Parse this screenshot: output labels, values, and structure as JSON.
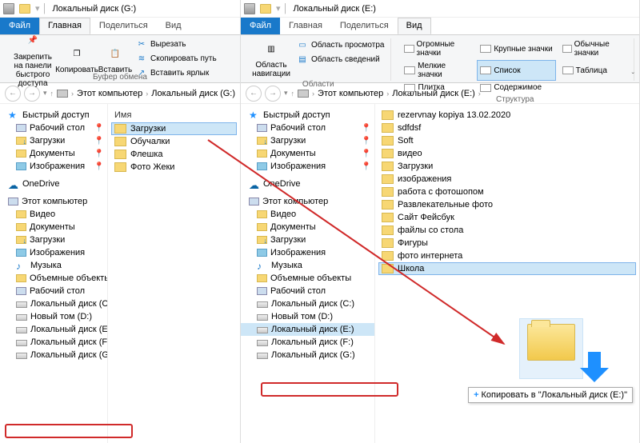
{
  "left": {
    "title": "Локальный диск (G:)",
    "tabs": {
      "file": "Файл",
      "home": "Главная",
      "share": "Поделиться",
      "view": "Вид"
    },
    "ribbon": {
      "pin": "Закрепить на панели быстрого доступа",
      "copy": "Копировать",
      "paste": "Вставить",
      "cut": "Вырезать",
      "copypath": "Скопировать путь",
      "pasteshort": "Вставить ярлык",
      "group_clip": "Буфер обмена"
    },
    "breadcrumb": {
      "pc": "Этот компьютер",
      "drive": "Локальный диск (G:)"
    },
    "tree": {
      "quick": "Быстрый доступ",
      "desktop": "Рабочий стол",
      "downloads": "Загрузки",
      "documents": "Документы",
      "pictures": "Изображения",
      "onedrive": "OneDrive",
      "thispc": "Этот компьютер",
      "video": "Видео",
      "documents2": "Документы",
      "downloads2": "Загрузки",
      "pictures2": "Изображения",
      "music": "Музыка",
      "objects": "Объемные объекты",
      "desktop2": "Рабочий стол",
      "drivec": "Локальный диск (C:)",
      "drived": "Новый том (D:)",
      "drivee": "Локальный диск (E:)",
      "drivef": "Локальный диск (F:)",
      "driveg": "Локальный диск (G:)"
    },
    "content": {
      "col_name": "Имя",
      "items": [
        "Загрузки",
        "Обучалки",
        "Флешка",
        "Фото Жеки"
      ]
    }
  },
  "right": {
    "title": "Локальный диск (E:)",
    "tabs": {
      "file": "Файл",
      "home": "Главная",
      "share": "Поделиться",
      "view": "Вид"
    },
    "ribbon": {
      "navpane": "Область навигации",
      "preview": "Область просмотра",
      "details": "Область сведений",
      "group_panes": "Области",
      "v_huge": "Огромные значки",
      "v_large": "Крупные значки",
      "v_normal": "Обычные значки",
      "v_small": "Мелкие значки",
      "v_list": "Список",
      "v_table": "Таблица",
      "v_tiles": "Плитка",
      "v_content": "Содержимое",
      "group_layout": "Структура"
    },
    "breadcrumb": {
      "pc": "Этот компьютер",
      "drive": "Локальный диск (E:)"
    },
    "tree": {
      "quick": "Быстрый доступ",
      "desktop": "Рабочий стол",
      "downloads": "Загрузки",
      "documents": "Документы",
      "pictures": "Изображения",
      "onedrive": "OneDrive",
      "thispc": "Этот компьютер",
      "video": "Видео",
      "documents2": "Документы",
      "downloads2": "Загрузки",
      "pictures2": "Изображения",
      "music": "Музыка",
      "objects": "Объемные объекты",
      "desktop2": "Рабочий стол",
      "drivec": "Локальный диск (C:)",
      "drived": "Новый том (D:)",
      "drivee": "Локальный диск (E:)",
      "drivef": "Локальный диск (F:)",
      "driveg": "Локальный диск (G:)"
    },
    "content": {
      "items": [
        "rezervnay kopiya 13.02.2020",
        "sdfdsf",
        "Soft",
        "видео",
        "Загрузки",
        "изображения",
        "работа с фотошопом",
        "Развлекательные фото",
        "Сайт Фейсбук",
        "файлы со стола",
        "Фигуры",
        "фото интернета",
        "Школа"
      ]
    },
    "tooltip": "Копировать в \"Локальный диск (E:)\""
  }
}
